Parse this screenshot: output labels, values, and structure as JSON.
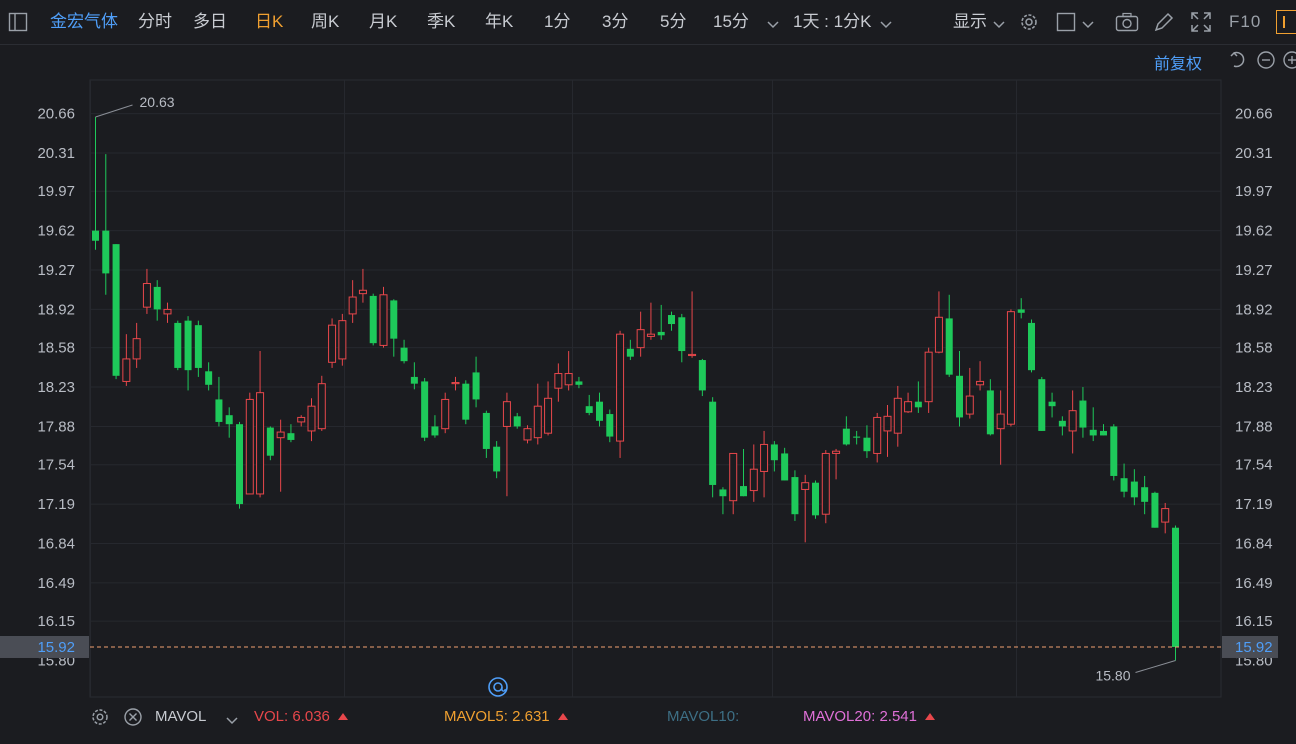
{
  "toolbar": {
    "stock_name": "金宏气体",
    "tabs": [
      "分时",
      "多日",
      "日K",
      "周K",
      "月K",
      "季K",
      "年K",
      "1分",
      "3分",
      "5分",
      "15分"
    ],
    "active_tab": "日K",
    "period_select": "1天 : 1分K",
    "display_label": "显示",
    "f10_label": "F10"
  },
  "adjust_label": "前复权",
  "colors": {
    "up": "#e8474b",
    "down": "#1ec95a",
    "price_line": "#f0a070",
    "accent": "#4f9ef8",
    "active_tab": "#f0a030"
  },
  "chart_data": {
    "type": "candlestick",
    "y_ticks": [
      "20.66",
      "20.31",
      "19.97",
      "19.62",
      "19.27",
      "18.92",
      "18.58",
      "18.23",
      "17.88",
      "17.54",
      "17.19",
      "16.84",
      "16.49",
      "16.15",
      "15.80"
    ],
    "ylim": [
      15.8,
      20.66
    ],
    "current_price": "15.92",
    "high_annotation": "20.63",
    "low_annotation": "15.80",
    "grid": true,
    "candles": [
      [
        19.62,
        19.53,
        20.63,
        19.45
      ],
      [
        19.62,
        19.24,
        20.3,
        19.05
      ],
      [
        19.5,
        18.33,
        19.5,
        18.3
      ],
      [
        18.28,
        18.48,
        18.7,
        18.24
      ],
      [
        18.48,
        18.66,
        18.8,
        18.4
      ],
      [
        18.94,
        19.15,
        19.28,
        18.88
      ],
      [
        19.12,
        18.92,
        19.18,
        18.82
      ],
      [
        18.88,
        18.92,
        18.98,
        18.8
      ],
      [
        18.8,
        18.4,
        18.82,
        18.38
      ],
      [
        18.82,
        18.38,
        18.86,
        18.2
      ],
      [
        18.78,
        18.4,
        18.82,
        18.32
      ],
      [
        18.37,
        18.25,
        18.45,
        18.2
      ],
      [
        18.12,
        17.92,
        18.32,
        17.88
      ],
      [
        17.98,
        17.9,
        18.05,
        17.78
      ],
      [
        17.9,
        17.19,
        17.92,
        17.15
      ],
      [
        17.28,
        18.12,
        18.18,
        17.28
      ],
      [
        17.28,
        18.18,
        18.55,
        17.25
      ],
      [
        17.87,
        17.62,
        17.88,
        17.58
      ],
      [
        17.78,
        17.83,
        17.94,
        17.3
      ],
      [
        17.82,
        17.76,
        17.9,
        17.74
      ],
      [
        17.92,
        17.96,
        17.98,
        17.88
      ],
      [
        17.84,
        18.06,
        18.13,
        17.75
      ],
      [
        17.86,
        18.26,
        18.33,
        17.84
      ],
      [
        18.45,
        18.78,
        18.84,
        18.4
      ],
      [
        18.48,
        18.82,
        18.88,
        18.42
      ],
      [
        18.88,
        19.03,
        19.18,
        18.8
      ],
      [
        19.06,
        19.09,
        19.28,
        18.98
      ],
      [
        19.04,
        18.62,
        19.06,
        18.6
      ],
      [
        18.6,
        19.05,
        19.12,
        18.58
      ],
      [
        19.0,
        18.66,
        19.01,
        18.5
      ],
      [
        18.58,
        18.46,
        18.65,
        18.44
      ],
      [
        18.32,
        18.26,
        18.45,
        18.21
      ],
      [
        18.28,
        17.78,
        18.31,
        17.75
      ],
      [
        17.88,
        17.8,
        17.98,
        17.78
      ],
      [
        17.86,
        18.12,
        18.18,
        17.82
      ],
      [
        18.26,
        18.27,
        18.32,
        18.2
      ],
      [
        18.26,
        17.94,
        18.29,
        17.9
      ],
      [
        18.36,
        18.12,
        18.5,
        18.05
      ],
      [
        18.0,
        17.68,
        18.02,
        17.6
      ],
      [
        17.7,
        17.48,
        17.75,
        17.42
      ],
      [
        17.88,
        18.1,
        18.18,
        17.26
      ],
      [
        17.97,
        17.88,
        18.0,
        17.86
      ],
      [
        17.76,
        17.86,
        17.89,
        17.73
      ],
      [
        17.78,
        18.06,
        18.26,
        17.72
      ],
      [
        17.82,
        18.13,
        18.28,
        17.8
      ],
      [
        18.22,
        18.35,
        18.44,
        18.1
      ],
      [
        18.25,
        18.35,
        18.55,
        18.2
      ],
      [
        18.28,
        18.25,
        18.32,
        18.22
      ],
      [
        18.06,
        18.0,
        18.16,
        17.98
      ],
      [
        18.1,
        17.93,
        18.18,
        17.88
      ],
      [
        17.99,
        17.79,
        18.03,
        17.74
      ],
      [
        17.75,
        18.7,
        18.73,
        17.6
      ],
      [
        18.57,
        18.5,
        18.65,
        18.47
      ],
      [
        18.58,
        18.74,
        18.9,
        18.5
      ],
      [
        18.68,
        18.7,
        18.98,
        18.65
      ],
      [
        18.72,
        18.69,
        18.96,
        18.65
      ],
      [
        18.87,
        18.79,
        18.9,
        18.73
      ],
      [
        18.85,
        18.55,
        18.88,
        18.45
      ],
      [
        18.51,
        18.52,
        19.08,
        18.49
      ],
      [
        18.47,
        18.2,
        18.48,
        18.15
      ],
      [
        18.1,
        17.36,
        18.14,
        17.25
      ],
      [
        17.32,
        17.26,
        17.34,
        17.1
      ],
      [
        17.22,
        17.64,
        17.64,
        17.1
      ],
      [
        17.35,
        17.26,
        17.68,
        17.26
      ],
      [
        17.31,
        17.5,
        17.72,
        17.21
      ],
      [
        17.48,
        17.72,
        17.84,
        17.25
      ],
      [
        17.72,
        17.58,
        17.75,
        17.48
      ],
      [
        17.64,
        17.4,
        17.69,
        17.4
      ],
      [
        17.43,
        17.1,
        17.49,
        17.04
      ],
      [
        17.32,
        17.38,
        17.45,
        16.85
      ],
      [
        17.38,
        17.09,
        17.4,
        17.06
      ],
      [
        17.1,
        17.64,
        17.67,
        17.02
      ],
      [
        17.64,
        17.66,
        17.68,
        17.41
      ],
      [
        17.86,
        17.72,
        17.97,
        17.71
      ],
      [
        17.79,
        17.78,
        17.84,
        17.72
      ],
      [
        17.78,
        17.66,
        17.89,
        17.6
      ],
      [
        17.64,
        17.96,
        18.0,
        17.56
      ],
      [
        17.84,
        17.97,
        18.07,
        17.61
      ],
      [
        17.82,
        18.13,
        18.24,
        17.7
      ],
      [
        18.01,
        18.1,
        18.18,
        18.0
      ],
      [
        18.1,
        18.05,
        18.28,
        18.0
      ],
      [
        18.1,
        18.54,
        18.58,
        18.0
      ],
      [
        18.54,
        18.85,
        19.08,
        18.53
      ],
      [
        18.84,
        18.34,
        19.05,
        18.32
      ],
      [
        18.33,
        17.96,
        18.55,
        17.88
      ],
      [
        17.99,
        18.15,
        18.4,
        17.95
      ],
      [
        18.25,
        18.28,
        18.46,
        18.2
      ],
      [
        18.2,
        17.81,
        18.3,
        17.8
      ],
      [
        17.86,
        17.99,
        18.2,
        17.54
      ],
      [
        17.9,
        18.9,
        18.92,
        17.88
      ],
      [
        18.92,
        18.89,
        19.02,
        18.84
      ],
      [
        18.8,
        18.38,
        18.83,
        18.36
      ],
      [
        18.3,
        17.84,
        18.32,
        17.84
      ],
      [
        18.1,
        18.06,
        18.18,
        17.96
      ],
      [
        17.93,
        17.88,
        17.97,
        17.8
      ],
      [
        17.84,
        18.02,
        18.2,
        17.64
      ],
      [
        18.11,
        17.87,
        18.23,
        17.78
      ],
      [
        17.85,
        17.8,
        18.05,
        17.75
      ],
      [
        17.84,
        17.8,
        17.9,
        17.8
      ],
      [
        17.88,
        17.44,
        17.9,
        17.4
      ],
      [
        17.42,
        17.3,
        17.55,
        17.25
      ],
      [
        17.39,
        17.25,
        17.5,
        17.18
      ],
      [
        17.34,
        17.21,
        17.44,
        17.1
      ],
      [
        17.29,
        16.98,
        17.3,
        16.98
      ],
      [
        17.03,
        17.15,
        17.2,
        16.93
      ],
      [
        16.98,
        15.92,
        17.0,
        15.8
      ]
    ],
    "volume_indicator": {
      "name": "MAVOL",
      "vol_label": "VOL:",
      "vol_value": "6.036",
      "ma5_label": "MAVOL5:",
      "ma5_value": "2.631",
      "ma10_label": "MAVOL10:",
      "ma20_label": "MAVOL20:",
      "ma20_value": "2.541"
    }
  }
}
